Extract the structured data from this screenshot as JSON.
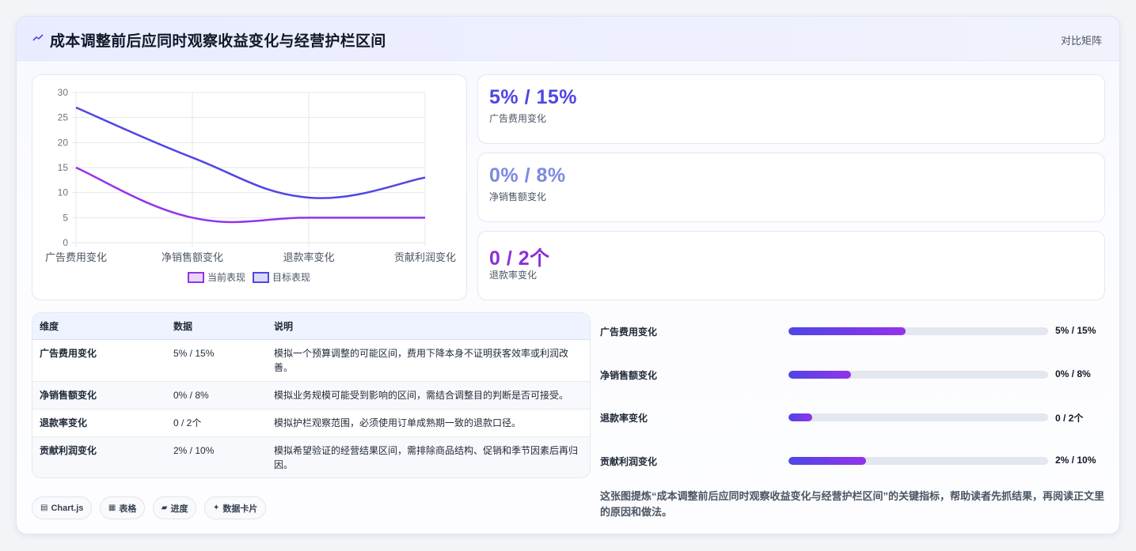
{
  "header": {
    "title": "成本调整前后应同时观察收益变化与经营护栏区间",
    "action": "对比矩阵",
    "icon": "trend-icon"
  },
  "chart_data": {
    "type": "line",
    "categories": [
      "广告费用变化",
      "净销售额变化",
      "退款率变化",
      "贡献利润变化"
    ],
    "series": [
      {
        "name": "当前表现",
        "values": [
          15,
          5,
          5,
          5
        ],
        "color": "#9333ea"
      },
      {
        "name": "目标表现",
        "values": [
          27,
          17,
          9,
          13
        ],
        "color": "#4f46e5"
      }
    ],
    "ylim": [
      0,
      30
    ],
    "yticks": [
      0,
      5,
      10,
      15,
      20,
      25,
      30
    ],
    "grid": true,
    "legend": "bottom"
  },
  "kpis": [
    {
      "value": "5% / 15%",
      "label": "广告费用变化",
      "color": "#4f46e5"
    },
    {
      "value": "0% / 8%",
      "label": "净销售额变化",
      "color": "#7c8ae0"
    },
    {
      "value": "0 / 2个",
      "label": "退款率变化",
      "color": "#8b2fd6"
    }
  ],
  "table": {
    "headers": [
      "维度",
      "数据",
      "说明"
    ],
    "rows": [
      [
        "广告费用变化",
        "5% / 15%",
        "模拟一个预算调整的可能区间，费用下降本身不证明获客效率或利润改善。"
      ],
      [
        "净销售额变化",
        "0% / 8%",
        "模拟业务规模可能受到影响的区间，需结合调整目的判断是否可接受。"
      ],
      [
        "退款率变化",
        "0 / 2个",
        "模拟护栏观察范围，必须使用订单成熟期一致的退款口径。"
      ],
      [
        "贡献利润变化",
        "2% / 10%",
        "模拟希望验证的经营结果区间，需排除商品结构、促销和季节因素后再归因。"
      ]
    ]
  },
  "progress": [
    {
      "label": "广告费用变化",
      "value": "5% / 15%",
      "fraction": 0.45
    },
    {
      "label": "净销售额变化",
      "value": "0% / 8%",
      "fraction": 0.24
    },
    {
      "label": "退款率变化",
      "value": "0 / 2个",
      "fraction": 0.09
    },
    {
      "label": "贡献利润变化",
      "value": "2% / 10%",
      "fraction": 0.3
    }
  ],
  "tags": [
    {
      "icon": "▤",
      "label": "Chart.js"
    },
    {
      "icon": "▦",
      "label": "表格"
    },
    {
      "icon": "▰",
      "label": "进度"
    },
    {
      "icon": "✦",
      "label": "数据卡片"
    }
  ],
  "footnote": "这张图提炼“成本调整前后应同时观察收益变化与经营护栏区间”的关键指标，帮助读者先抓结果，再阅读正文里的原因和做法。"
}
